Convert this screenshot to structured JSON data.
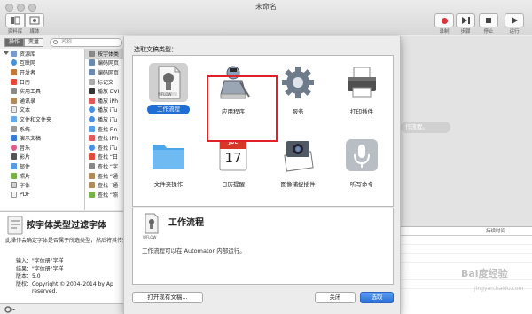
{
  "window": {
    "title": "未命名"
  },
  "toolbar": {
    "library_label": "资料库",
    "media_label": "媒体",
    "record_label": "录制",
    "step_label": "步骤",
    "stop_label": "停止",
    "run_label": "运行"
  },
  "left": {
    "tab_actions": "操作",
    "tab_variables": "变量",
    "search_placeholder": "名称",
    "library_items": [
      "资源库",
      "互联网",
      "开发者",
      "日历",
      "实用工具",
      "通讯录",
      "文本",
      "文件和文件夹",
      "系统",
      "演示文稿",
      "音乐",
      "影片",
      "邮件",
      "照片",
      "字体",
      "PDF"
    ],
    "action_items": [
      "按字体类",
      "编码网页",
      "编码网页",
      "标记文",
      "播放 DVI",
      "播放 iPh",
      "播放 iTu",
      "播放 iTu",
      "查找 Fin",
      "查找 iPh",
      "查找 iTu",
      "查找 “日",
      "查找 “字",
      "查找 “通",
      "查找 “通",
      "查找 “照"
    ]
  },
  "info": {
    "title": "按字体类型过滤字体",
    "description": "此操作会确定字体是否属于所选类型，然后将其传递下一个操作。",
    "rows": [
      {
        "key": "输入：",
        "value": "\"字体册\"字样"
      },
      {
        "key": "结果：",
        "value": "\"字体册\"字样"
      },
      {
        "key": "版本：",
        "value": "5.0"
      },
      {
        "key": "版权：",
        "value": "Copyright © 2004–2014 by Ap"
      },
      {
        "key": "",
        "value": "reserved."
      }
    ]
  },
  "workflow_hint": "作流程。",
  "log": {
    "column_header": "持续时间"
  },
  "sheet": {
    "title": "选取文稿类型：",
    "types": [
      {
        "label": "工作流程",
        "art": "workflow-icon",
        "selected": true
      },
      {
        "label": "应用程序",
        "art": "application-icon",
        "selected": false
      },
      {
        "label": "服务",
        "art": "service-icon",
        "selected": false
      },
      {
        "label": "打印插件",
        "art": "printer-icon",
        "selected": false
      },
      {
        "label": "文件夹操作",
        "art": "folder-icon",
        "selected": false
      },
      {
        "label": "日历提醒",
        "art": "calendar-icon",
        "selected": false
      },
      {
        "label": "图像捕捉插件",
        "art": "image-capture-icon",
        "selected": false
      },
      {
        "label": "听写命令",
        "art": "microphone-icon",
        "selected": false
      }
    ],
    "calendar_month": "JUL",
    "calendar_day": "17",
    "wflow_tag": "WFLOW",
    "preview": {
      "title": "工作流程",
      "description": "工作流程可以在 Automator 内部运行。"
    },
    "open_existing": "打开现有文稿...",
    "close": "关闭",
    "choose": "选取"
  },
  "watermark": {
    "main": "Bai度经验",
    "sub": "jingyan.baidu.com"
  },
  "colors": {
    "highlight": "#e3202a",
    "accent": "#1f6ed6"
  }
}
